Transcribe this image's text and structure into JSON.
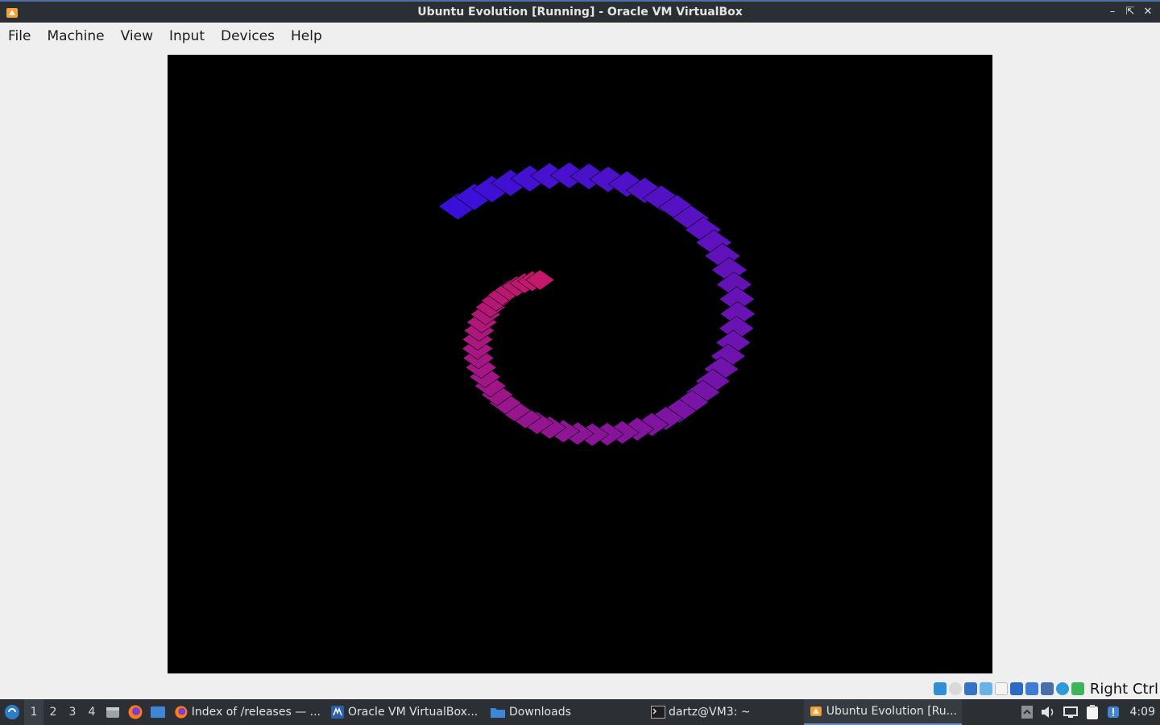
{
  "window": {
    "title": "Ubuntu Evolution [Running] - Oracle VM VirtualBox"
  },
  "menu": {
    "items": [
      "File",
      "Machine",
      "View",
      "Input",
      "Devices",
      "Help"
    ]
  },
  "vm_display": {
    "scene": "spiral of rotated diamond tiles",
    "colors": {
      "start": "#3a10d8",
      "end": "#c4186a"
    }
  },
  "statusbar": {
    "icons": [
      "hard-disk-icon",
      "optical-drive-icon",
      "network-icon",
      "usb-icon",
      "shared-folders-icon",
      "display-icon",
      "video-capture-icon",
      "cpu-icon",
      "keyboard-capture-icon",
      "mouse-integration-icon"
    ],
    "host_key": "Right Ctrl"
  },
  "taskbar": {
    "workspaces": [
      "1",
      "2",
      "3",
      "4"
    ],
    "active_workspace": "1",
    "tasks": [
      {
        "label": "Index of /releases — ...",
        "icon": "firefox-icon"
      },
      {
        "label": "Oracle VM VirtualBox...",
        "icon": "virtualbox-icon"
      },
      {
        "label": "Downloads",
        "icon": "folder-icon"
      },
      {
        "label": "dartz@VM3: ~",
        "icon": "terminal-icon"
      },
      {
        "label": "Ubuntu Evolution [Ru...",
        "icon": "virtualbox-vm-icon"
      }
    ],
    "clock": "4:09"
  }
}
